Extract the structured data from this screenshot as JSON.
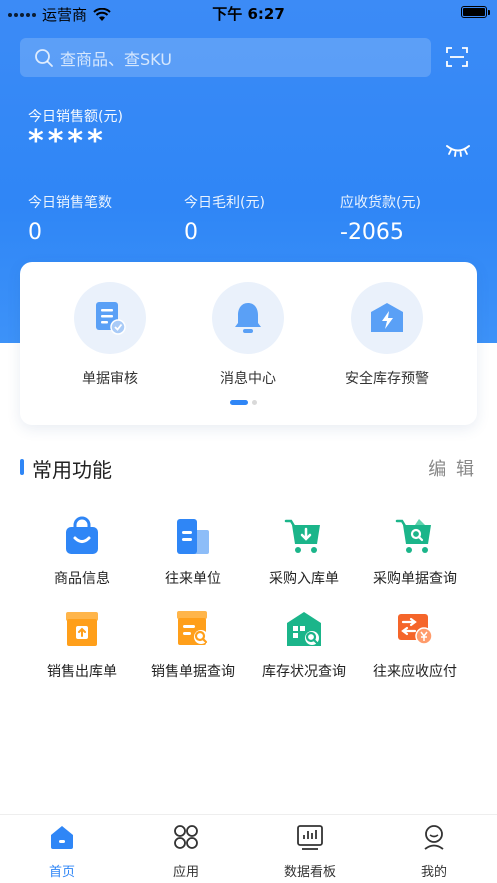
{
  "status_bar": {
    "carrier": "运营商",
    "time": "下午 6:27"
  },
  "search": {
    "placeholder": "查商品、查SKU"
  },
  "sales": {
    "label": "今日销售额(元)",
    "value": "****"
  },
  "stats": [
    {
      "label": "今日销售笔数",
      "value": "0"
    },
    {
      "label": "今日毛利(元)",
      "value": "0"
    },
    {
      "label": "应收货款(元)",
      "value": "-2065"
    }
  ],
  "quick_card": {
    "items": [
      {
        "label": "单据审核",
        "icon": "document-check-icon"
      },
      {
        "label": "消息中心",
        "icon": "bell-icon"
      },
      {
        "label": "安全库存预警",
        "icon": "warehouse-alert-icon"
      }
    ],
    "page": 1,
    "pages": 2
  },
  "common_functions": {
    "title": "常用功能",
    "edit_label": "编 辑",
    "items": [
      {
        "label": "商品信息",
        "icon": "shopping-bag-icon"
      },
      {
        "label": "往来单位",
        "icon": "building-icon"
      },
      {
        "label": "采购入库单",
        "icon": "cart-in-icon"
      },
      {
        "label": "采购单据查询",
        "icon": "cart-search-icon"
      },
      {
        "label": "销售出库单",
        "icon": "box-out-icon"
      },
      {
        "label": "销售单据查询",
        "icon": "sales-search-icon"
      },
      {
        "label": "库存状况查询",
        "icon": "warehouse-search-icon"
      },
      {
        "label": "往来应收应付",
        "icon": "exchange-money-icon"
      }
    ]
  },
  "tabbar": {
    "items": [
      {
        "label": "首页",
        "icon": "home-icon",
        "active": true
      },
      {
        "label": "应用",
        "icon": "apps-icon",
        "active": false
      },
      {
        "label": "数据看板",
        "icon": "dashboard-icon",
        "active": false
      },
      {
        "label": "我的",
        "icon": "profile-icon",
        "active": false
      }
    ]
  },
  "colors": {
    "primary": "#2F86F6",
    "green": "#1BB58A",
    "orange": "#FF9F1A",
    "red_orange": "#F5652A"
  }
}
